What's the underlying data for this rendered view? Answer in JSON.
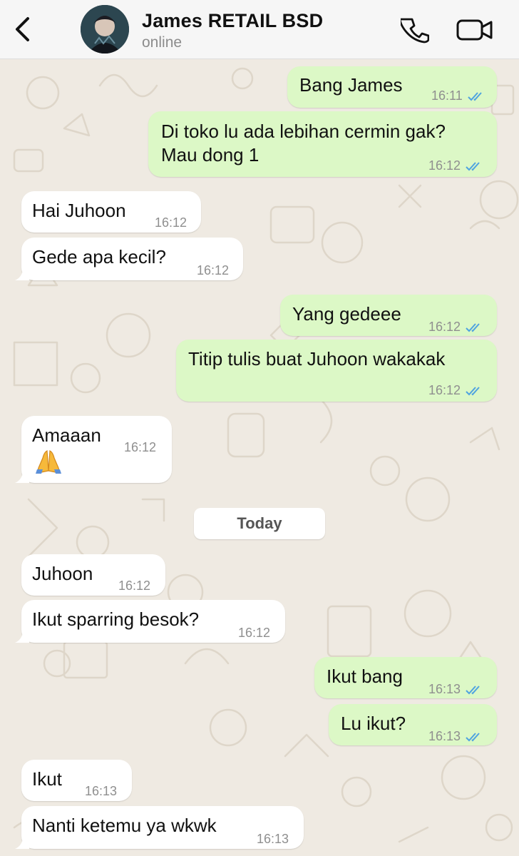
{
  "header": {
    "contact_name": "James RETAIL BSD",
    "status": "online"
  },
  "date_separator": "Today",
  "messages": [
    {
      "direction": "out",
      "text": "Bang James",
      "time": "16:11",
      "read": true
    },
    {
      "direction": "out",
      "text_lines": [
        "Di toko lu ada lebihan cermin gak?",
        "Mau dong 1"
      ],
      "time": "16:12",
      "read": true
    },
    {
      "direction": "in",
      "text": "Hai Juhoon",
      "time": "16:12"
    },
    {
      "direction": "in",
      "text": "Gede apa kecil?",
      "time": "16:12"
    },
    {
      "direction": "out",
      "text": "Yang gedeee",
      "time": "16:12",
      "read": true
    },
    {
      "direction": "out",
      "text": "Titip tulis buat Juhoon wakakak",
      "time": "16:12",
      "read": true
    },
    {
      "direction": "in",
      "text": "Amaaan",
      "time": "16:12",
      "emoji": "folded-hands"
    },
    {
      "direction": "in",
      "text": "Juhoon",
      "time": "16:12"
    },
    {
      "direction": "in",
      "text": "Ikut sparring besok?",
      "time": "16:12"
    },
    {
      "direction": "out",
      "text": "Ikut bang",
      "time": "16:13",
      "read": true
    },
    {
      "direction": "out",
      "text": "Lu ikut?",
      "time": "16:13",
      "read": true
    },
    {
      "direction": "in",
      "text": "Ikut",
      "time": "16:13"
    },
    {
      "direction": "in",
      "text": "Nanti ketemu ya wkwk",
      "time": "16:13"
    }
  ],
  "icons": {
    "back": "chevron-left-icon",
    "call": "phone-icon",
    "video": "video-camera-icon",
    "read_receipt": "double-check-icon"
  },
  "colors": {
    "outgoing_bubble": "#dcf8c6",
    "incoming_bubble": "#ffffff",
    "background": "#efeae2",
    "read_ticks": "#4fa3e0",
    "header_bg": "#f6f6f6"
  }
}
